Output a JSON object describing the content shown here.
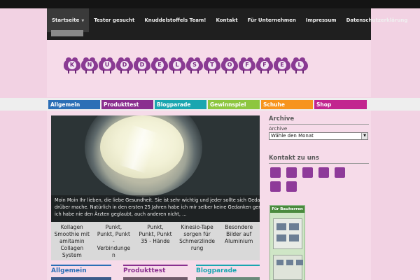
{
  "nav": {
    "items": [
      {
        "label": "Startseite",
        "active": true,
        "has_dropdown": true
      },
      {
        "label": "Tester gesucht"
      },
      {
        "label": "Knuddelstoffels Team!"
      },
      {
        "label": "Kontakt"
      },
      {
        "label": "Für Unternehmen"
      },
      {
        "label": "Impressum"
      },
      {
        "label": "Datenschutzerklärung"
      }
    ]
  },
  "logo": {
    "letters": [
      "K",
      "N",
      "U",
      "D",
      "D",
      "E",
      "L",
      "S",
      "T",
      "O",
      "F",
      "F",
      "E",
      "L"
    ]
  },
  "categories": [
    {
      "label": "Allgemein",
      "color": "#2b6fb6"
    },
    {
      "label": "Produkttest",
      "color": "#8a2f8f"
    },
    {
      "label": "Blogparade",
      "color": "#1aa6b0"
    },
    {
      "label": "Gewinnspiel",
      "color": "#8dc63f"
    },
    {
      "label": "Schuhe",
      "color": "#f7941d"
    },
    {
      "label": "Shop",
      "color": "#c2258f"
    }
  ],
  "slider": {
    "caption_lines": [
      "Moin Moin Ihr lieben, die liebe Gesundheit. Sie ist sehr wichtig und jeder sollte sich  Gedanken",
      "drüber mache. Natürlich in den ersten 25 Jahren habe ich mir selber keine Gedanken gemacht,",
      "ich habe nie den Ärzten geglaubt, auch anderen nicht, …"
    ]
  },
  "thumbs": [
    {
      "lines": [
        "Kollagen",
        "Smoothie mit",
        "amitamin",
        "Collagen",
        "System"
      ]
    },
    {
      "lines": [
        "Punkt,",
        "Punkt, Punkt",
        "-",
        "Verbindunge",
        "n"
      ]
    },
    {
      "lines": [
        "Punkt,",
        "Punkt, Punkt",
        "35 - Hände"
      ]
    },
    {
      "lines": [
        "Kinesio-Tape",
        "sorgen für",
        "Schmerzlinde",
        "rung"
      ]
    },
    {
      "lines": [
        "Besondere",
        "Bilder auf",
        "Aluminium"
      ]
    }
  ],
  "blocks": [
    {
      "title": "Allgemein",
      "color": "#2b6fb6"
    },
    {
      "title": "Produkttest",
      "color": "#8a2f8f"
    },
    {
      "title": "Blogparade",
      "color": "#1aa6b0"
    }
  ],
  "sidebar": {
    "archive_heading": "Archive",
    "archive_label": "Archive",
    "archive_select": "Wähle den Monat",
    "contact_heading": "Kontakt zu uns",
    "social_icon_count": 7,
    "ad_title": "Für Bauherren",
    "icon_color": "#8e3a99"
  }
}
